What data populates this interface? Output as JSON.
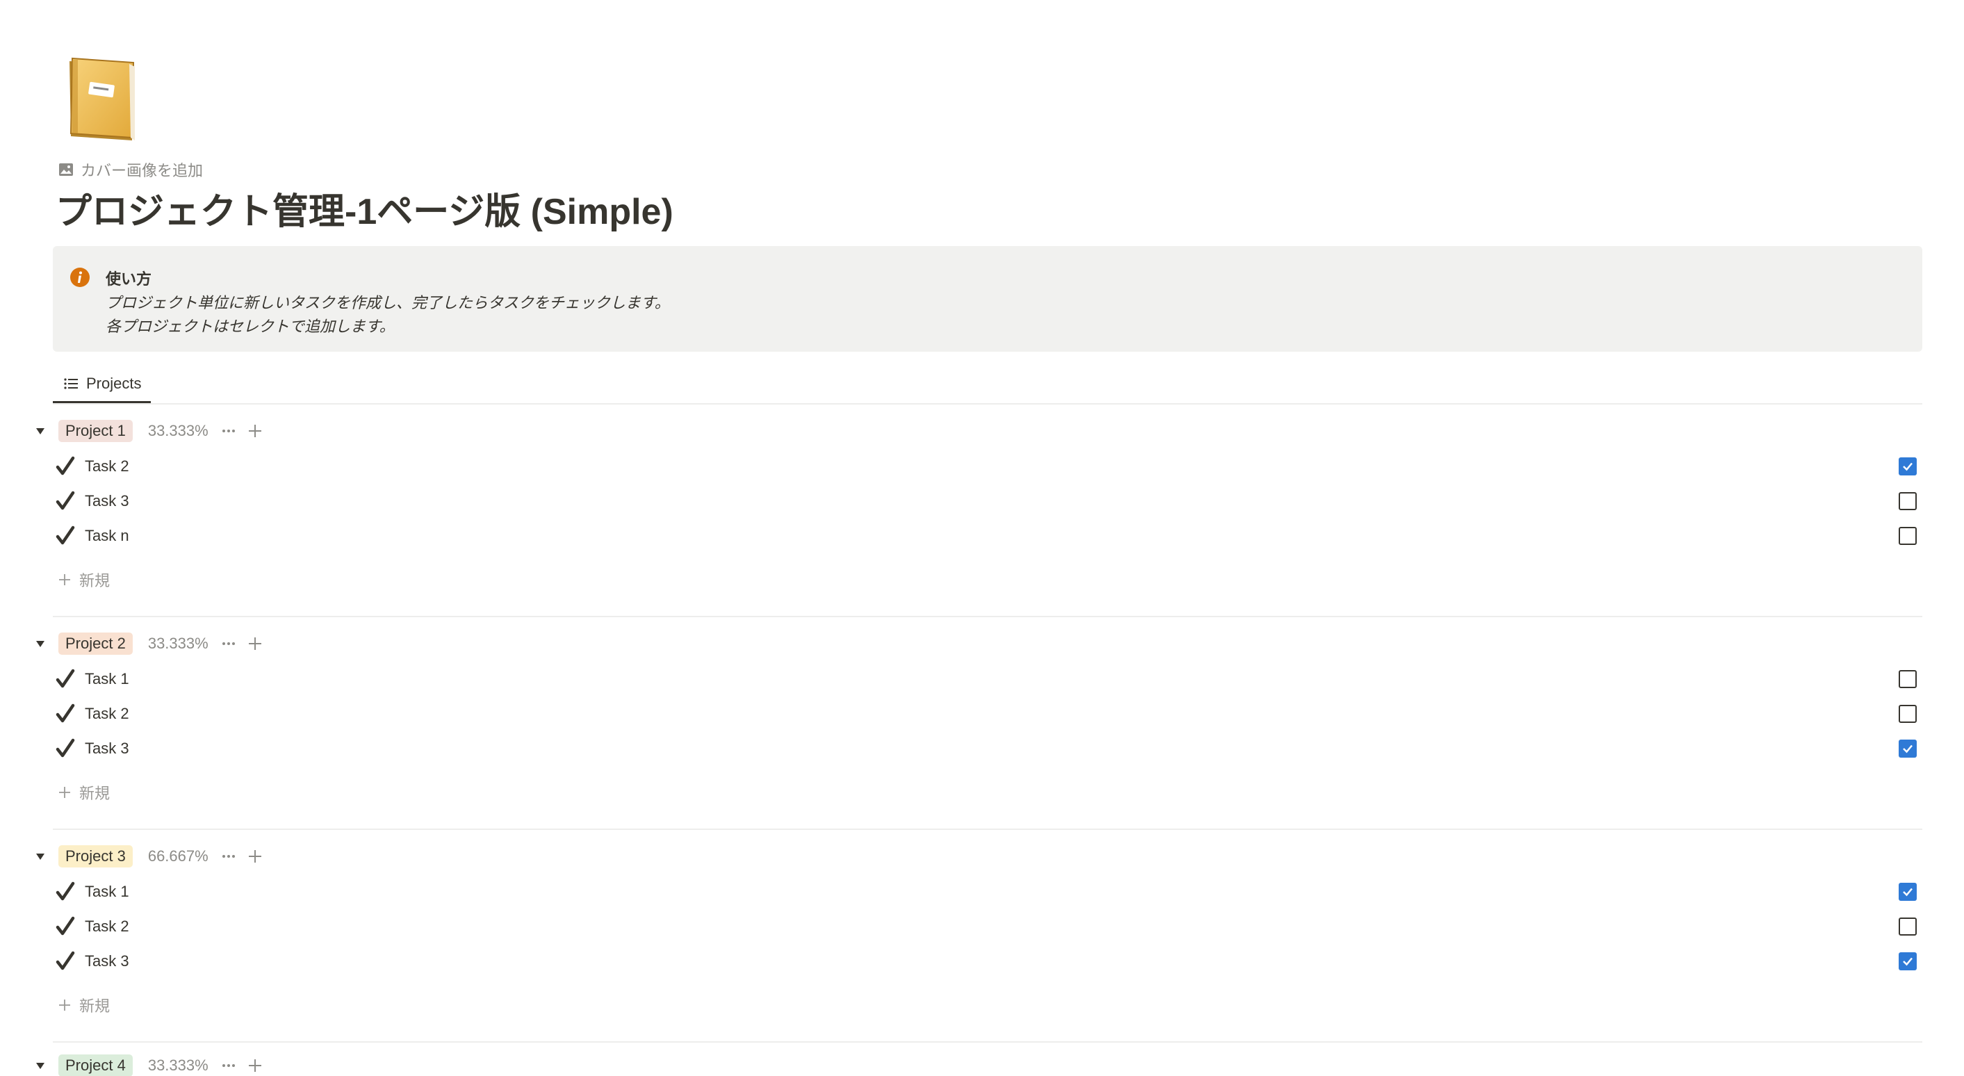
{
  "page": {
    "icon": "notebook-icon",
    "add_cover_label": "カバー画像を追加",
    "title": "プロジェクト管理-1ページ版 (Simple)"
  },
  "callout": {
    "icon": "info-icon",
    "icon_color": "#d9730d",
    "title": "使い方",
    "line1": "プロジェクト単位に新しいタスクを作成し、完了したらタスクをチェックします。",
    "line2": "各プロジェクトはセレクトで追加します。"
  },
  "view_tabs": [
    {
      "label": "Projects",
      "icon": "list-icon",
      "active": true
    }
  ],
  "groups": [
    {
      "name": "Project 1",
      "percent": "33.333%",
      "tag_color": "#f3e1dc",
      "tasks": [
        {
          "name": "Task 2",
          "done": true
        },
        {
          "name": "Task 3",
          "done": false
        },
        {
          "name": "Task n",
          "done": false
        }
      ],
      "new_label": "新規"
    },
    {
      "name": "Project 2",
      "percent": "33.333%",
      "tag_color": "#f9e1d1",
      "tasks": [
        {
          "name": "Task 1",
          "done": false
        },
        {
          "name": "Task 2",
          "done": false
        },
        {
          "name": "Task 3",
          "done": true
        }
      ],
      "new_label": "新規"
    },
    {
      "name": "Project 3",
      "percent": "66.667%",
      "tag_color": "#fcefc8",
      "tasks": [
        {
          "name": "Task 1",
          "done": true
        },
        {
          "name": "Task 2",
          "done": false
        },
        {
          "name": "Task 3",
          "done": true
        }
      ],
      "new_label": "新規"
    },
    {
      "name": "Project 4",
      "percent": "33.333%",
      "tag_color": "#dbeddb",
      "tasks": [],
      "new_label": ""
    }
  ],
  "colors": {
    "checkbox_checked": "#2f7ad6",
    "text": "#37352f",
    "muted": "#8c8b87"
  }
}
